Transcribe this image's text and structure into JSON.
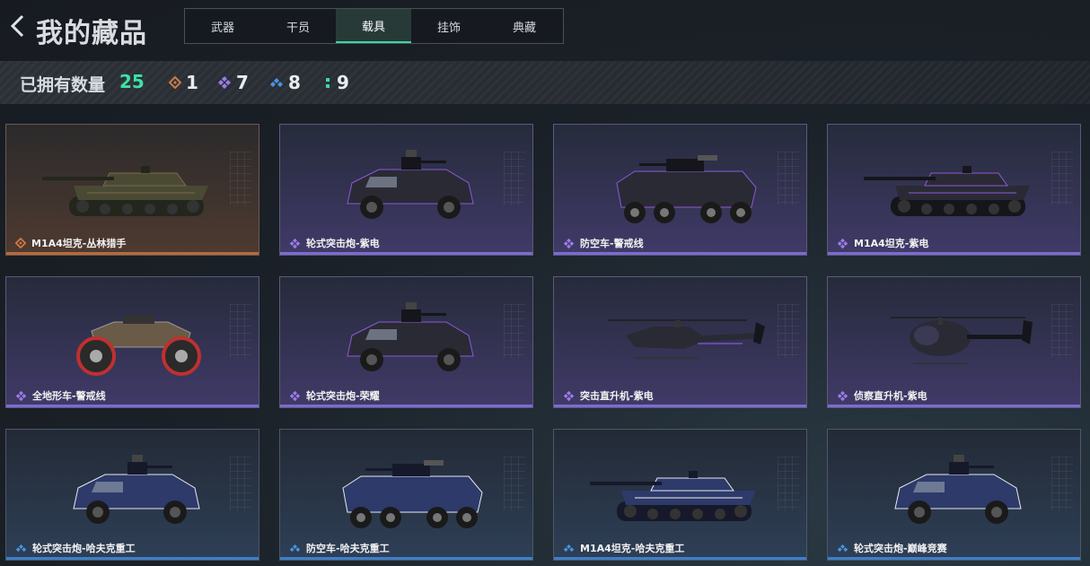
{
  "header": {
    "title": "我的藏品",
    "tabs": [
      {
        "label": "武器",
        "active": false
      },
      {
        "label": "干员",
        "active": false
      },
      {
        "label": "载具",
        "active": true
      },
      {
        "label": "挂饰",
        "active": false
      },
      {
        "label": "典藏",
        "active": false
      }
    ]
  },
  "stats": {
    "owned_label": "已拥有数量",
    "owned_count": "25",
    "rarity_counts": [
      {
        "icon": "gold-diamond-icon",
        "color": "#d07a45",
        "count": "1"
      },
      {
        "icon": "purple-diamond-icon",
        "color": "#9b7de8",
        "count": "7"
      },
      {
        "icon": "blue-diamond-icon",
        "color": "#4b94e0",
        "count": "8"
      },
      {
        "icon": "green-dots-icon",
        "color": "#3fd8a8",
        "count": "9"
      }
    ]
  },
  "colors": {
    "accent": "#39d6a0",
    "gold": "#d07a45",
    "purple": "#9b7de8",
    "blue": "#4b94e0"
  },
  "items": [
    {
      "name": "M1A4坦克-丛林猎手",
      "rarity": "gold",
      "vehicle": "tank"
    },
    {
      "name": "轮式突击炮-紫电",
      "rarity": "purple",
      "vehicle": "armored-car"
    },
    {
      "name": "防空车-警戒线",
      "rarity": "purple",
      "vehicle": "apc"
    },
    {
      "name": "M1A4坦克-紫电",
      "rarity": "purple",
      "vehicle": "tank"
    },
    {
      "name": "全地形车-警戒线",
      "rarity": "purple",
      "vehicle": "atv"
    },
    {
      "name": "轮式突击炮-荣耀",
      "rarity": "purple",
      "vehicle": "armored-car"
    },
    {
      "name": "突击直升机-紫电",
      "rarity": "purple",
      "vehicle": "attack-helicopter"
    },
    {
      "name": "侦察直升机-紫电",
      "rarity": "purple",
      "vehicle": "scout-helicopter"
    },
    {
      "name": "轮式突击炮-哈夫克重工",
      "rarity": "blue",
      "vehicle": "armored-car"
    },
    {
      "name": "防空车-哈夫克重工",
      "rarity": "blue",
      "vehicle": "apc"
    },
    {
      "name": "M1A4坦克-哈夫克重工",
      "rarity": "blue",
      "vehicle": "tank"
    },
    {
      "name": "轮式突击炮-巅峰竞赛",
      "rarity": "blue",
      "vehicle": "armored-car"
    }
  ]
}
